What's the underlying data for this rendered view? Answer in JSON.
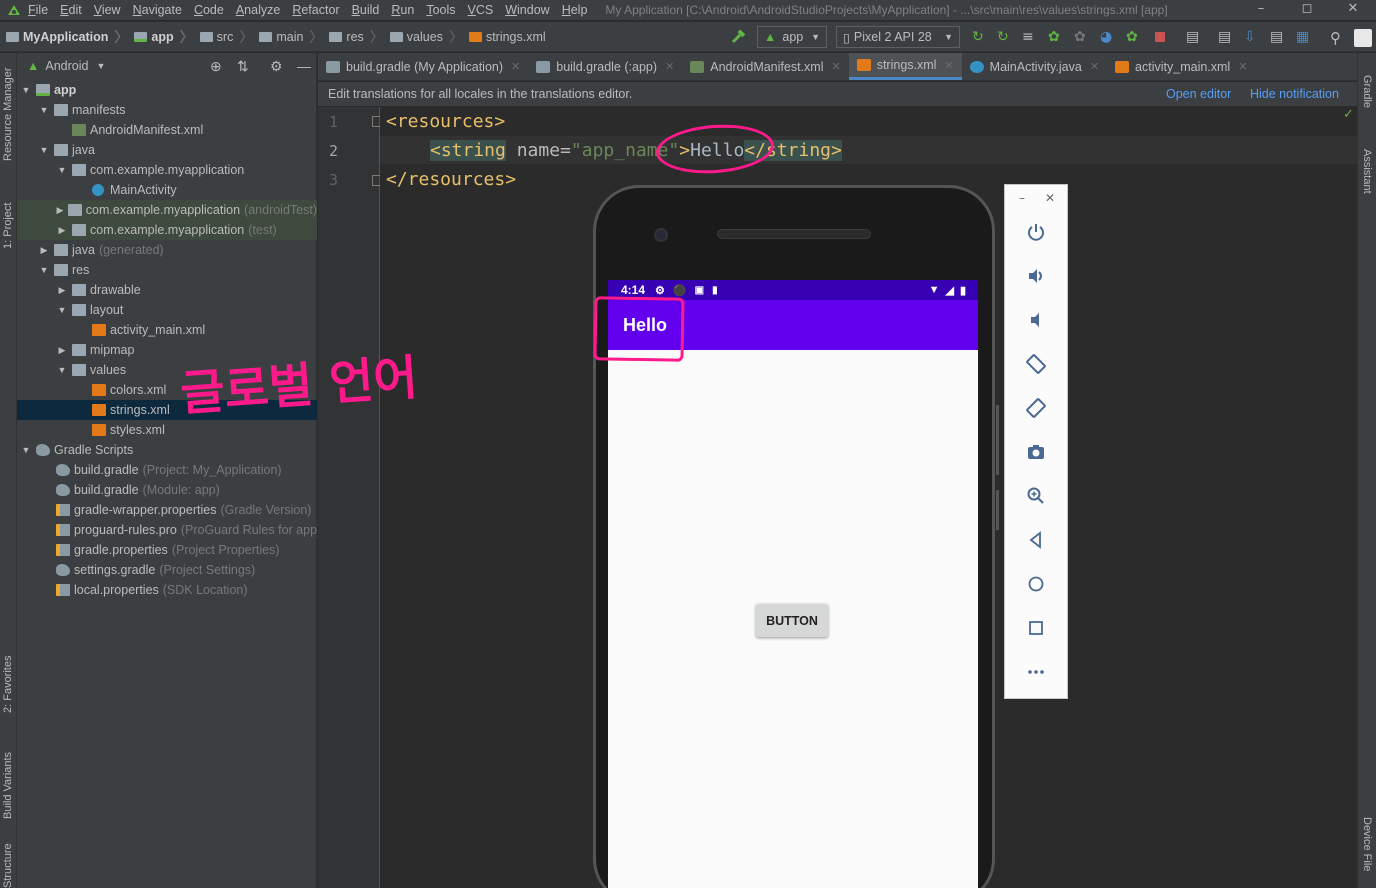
{
  "menu": [
    "File",
    "Edit",
    "View",
    "Navigate",
    "Code",
    "Analyze",
    "Refactor",
    "Build",
    "Run",
    "Tools",
    "VCS",
    "Window",
    "Help"
  ],
  "window_title": "My Application [C:\\Android\\AndroidStudioProjects\\MyApplication] - ...\\src\\main\\res\\values\\strings.xml [app]",
  "breadcrumb": [
    "MyApplication",
    "app",
    "src",
    "main",
    "res",
    "values",
    "strings.xml"
  ],
  "toolbar": {
    "run_config": "app",
    "device": "Pixel 2 API 28"
  },
  "project": {
    "view_mode": "Android",
    "tree": [
      {
        "label": "app",
        "hint": ""
      },
      {
        "label": "manifests",
        "hint": ""
      },
      {
        "label": "AndroidManifest.xml",
        "hint": ""
      },
      {
        "label": "java",
        "hint": ""
      },
      {
        "label": "com.example.myapplication",
        "hint": ""
      },
      {
        "label": "MainActivity",
        "hint": ""
      },
      {
        "label": "com.example.myapplication",
        "hint": "(androidTest)"
      },
      {
        "label": "com.example.myapplication",
        "hint": "(test)"
      },
      {
        "label": "java",
        "hint": "(generated)"
      },
      {
        "label": "res",
        "hint": ""
      },
      {
        "label": "drawable",
        "hint": ""
      },
      {
        "label": "layout",
        "hint": ""
      },
      {
        "label": "activity_main.xml",
        "hint": ""
      },
      {
        "label": "mipmap",
        "hint": ""
      },
      {
        "label": "values",
        "hint": ""
      },
      {
        "label": "colors.xml",
        "hint": ""
      },
      {
        "label": "strings.xml",
        "hint": ""
      },
      {
        "label": "styles.xml",
        "hint": ""
      },
      {
        "label": "Gradle Scripts",
        "hint": ""
      },
      {
        "label": "build.gradle",
        "hint": "(Project: My_Application)"
      },
      {
        "label": "build.gradle",
        "hint": "(Module: app)"
      },
      {
        "label": "gradle-wrapper.properties",
        "hint": "(Gradle Version)"
      },
      {
        "label": "proguard-rules.pro",
        "hint": "(ProGuard Rules for app)"
      },
      {
        "label": "gradle.properties",
        "hint": "(Project Properties)"
      },
      {
        "label": "settings.gradle",
        "hint": "(Project Settings)"
      },
      {
        "label": "local.properties",
        "hint": "(SDK Location)"
      }
    ]
  },
  "left_tool_tabs": [
    "Resource Manager",
    "1: Project",
    "2: Favorites",
    "Build Variants",
    "Structure"
  ],
  "right_tool_tabs": [
    "Gradle",
    "Assistant",
    "Device File"
  ],
  "editor_tabs": [
    {
      "label": "build.gradle (My Application)"
    },
    {
      "label": "build.gradle (:app)"
    },
    {
      "label": "AndroidManifest.xml"
    },
    {
      "label": "strings.xml"
    },
    {
      "label": "MainActivity.java"
    },
    {
      "label": "activity_main.xml"
    }
  ],
  "notification": {
    "text": "Edit translations for all locales in the translations editor.",
    "open_editor": "Open editor",
    "hide": "Hide notification"
  },
  "code": {
    "line_numbers": [
      "1",
      "2",
      "3"
    ],
    "line1": "<resources>",
    "line2_open": "<string",
    "line2_attr": " name=",
    "line2_val": "\"app_name\"",
    "line2_gt": ">",
    "line2_text": "Hello",
    "line2_close": "</string>",
    "line3": "</resources>"
  },
  "emulator": {
    "time": "4:14",
    "app_title": "Hello",
    "button_label": "BUTTON",
    "panel_buttons": [
      "power-icon",
      "volume-up-icon",
      "volume-down-icon",
      "rotate-left-icon",
      "rotate-right-icon",
      "camera-icon",
      "zoom-icon",
      "back-icon",
      "home-icon",
      "overview-icon",
      "more-icon"
    ]
  },
  "annotation_text": "글로벌 언어",
  "colors": {
    "annotation": "#ff1a8c",
    "accent": "#6200ee",
    "status_bar": "#3700b3"
  }
}
